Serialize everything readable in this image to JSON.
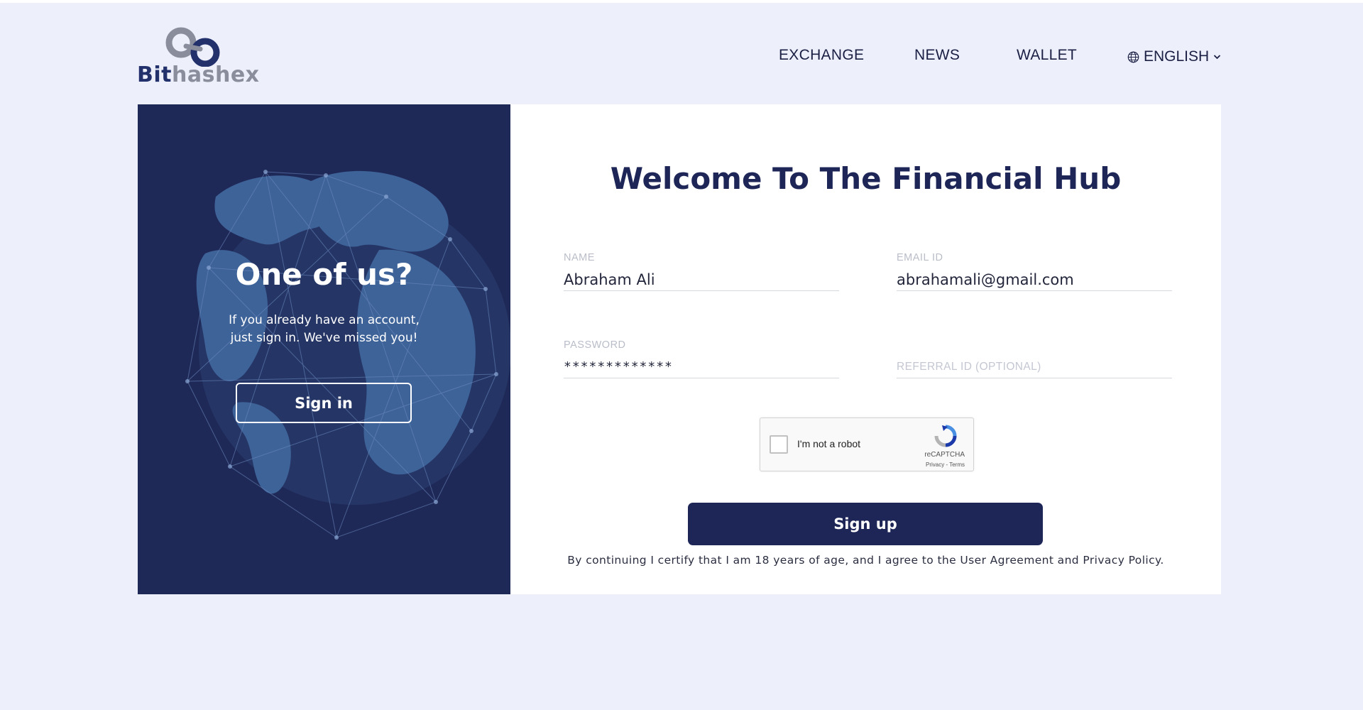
{
  "header": {
    "logo_text_dark": "Bit",
    "logo_text_light": "hashex",
    "nav": [
      "EXCHANGE",
      "NEWS",
      "WALLET"
    ],
    "language": "ENGLISH"
  },
  "left_panel": {
    "title": "One of us?",
    "subtitle_line1": "If you already have an account,",
    "subtitle_line2": "just sign in. We've missed you!",
    "signin_label": "Sign in"
  },
  "form": {
    "heading": "Welcome To The Financial Hub",
    "name_label": "NAME",
    "name_value": "Abraham Ali",
    "email_label": "EMAIL ID",
    "email_value": "abrahamali@gmail.com",
    "password_label": "PASSWORD",
    "password_value": "*************",
    "referral_placeholder": "REFERRAL ID (OPTIONAL)",
    "captcha_text": "I'm not a robot",
    "captcha_brand": "reCAPTCHA",
    "captcha_terms": "Privacy - Terms",
    "signup_label": "Sign up",
    "legal": "By continuing I certify that I am 18 years of age, and I agree to the User Agreement and Privacy Policy."
  },
  "colors": {
    "page_bg": "#edf0fb",
    "navy": "#1e2657",
    "panel": "#1f2958",
    "globe": "#3a5c8e"
  }
}
